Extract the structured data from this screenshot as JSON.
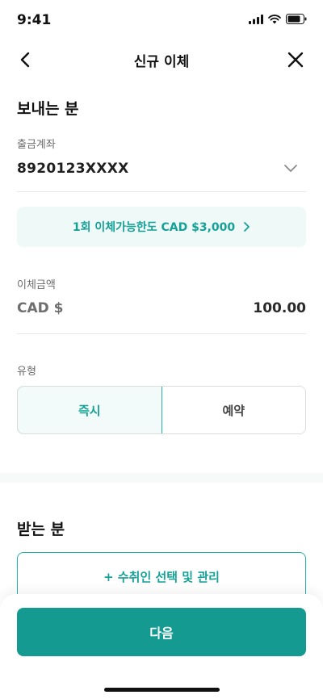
{
  "status_bar": {
    "time": "9:41"
  },
  "nav": {
    "title": "신규 이체"
  },
  "sender": {
    "section_title": "보내는 분",
    "account_label": "출금계좌",
    "account_number": "8920123XXXX"
  },
  "limit_banner": {
    "text": "1회 이체가능한도 CAD $3,000"
  },
  "amount": {
    "label": "이체금액",
    "currency": "CAD $",
    "value": "100.00"
  },
  "transfer_type": {
    "label": "유형",
    "options": [
      {
        "label": "즉시",
        "selected": true
      },
      {
        "label": "예약",
        "selected": false
      }
    ]
  },
  "recipient": {
    "section_title": "받는 분",
    "button_label": "+ 수취인 선택 및 관리"
  },
  "footer": {
    "next_label": "다음"
  },
  "colors": {
    "accent": "#16a196",
    "primary_button": "#149a90",
    "banner_bg": "#eef9f8"
  },
  "icons": [
    "back-arrow-icon",
    "close-icon",
    "chevron-down-icon",
    "chevron-right-icon",
    "signal-icon",
    "wifi-icon",
    "battery-icon"
  ]
}
